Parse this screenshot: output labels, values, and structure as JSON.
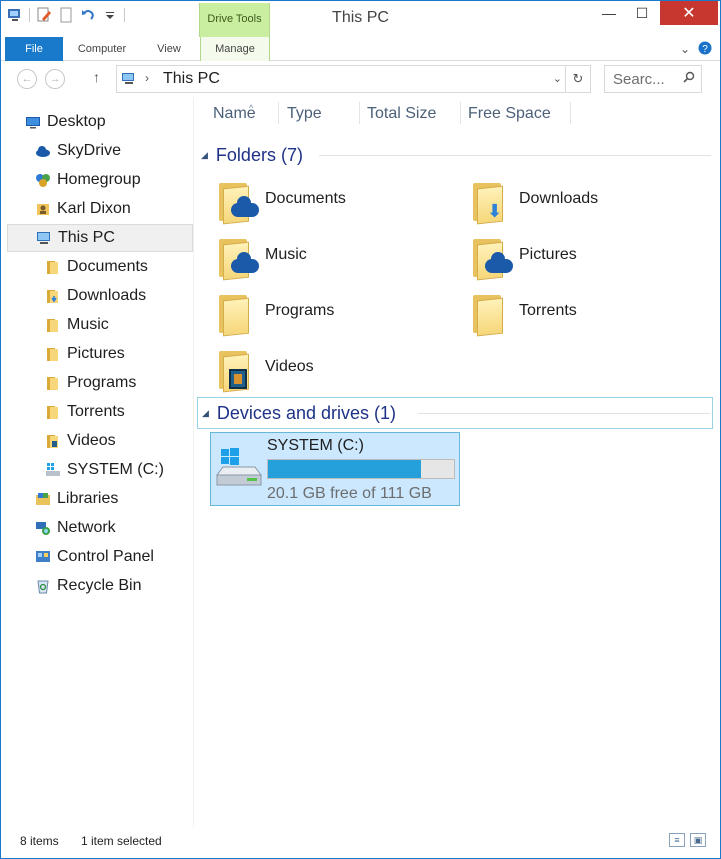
{
  "window": {
    "title": "This PC"
  },
  "titlebar": {
    "context_tab_group": "Drive Tools",
    "minimize": "—",
    "maximize": "☐",
    "close": "✕"
  },
  "ribbon": {
    "tabs": [
      "File",
      "Computer",
      "View",
      "Manage"
    ],
    "expand": "⌄",
    "help": "?"
  },
  "address": {
    "crumb": "This PC",
    "search_placeholder": "Searc..."
  },
  "nav_pane": {
    "items": [
      {
        "label": "Desktop",
        "icon": "desktop-icon"
      },
      {
        "label": "SkyDrive",
        "icon": "skydrive-icon"
      },
      {
        "label": "Homegroup",
        "icon": "homegroup-icon"
      },
      {
        "label": "Karl Dixon",
        "icon": "user-folder-icon"
      },
      {
        "label": "This PC",
        "icon": "this-pc-icon",
        "selected": true
      },
      {
        "label": "Documents",
        "icon": "folder-icon"
      },
      {
        "label": "Downloads",
        "icon": "folder-icon"
      },
      {
        "label": "Music",
        "icon": "folder-icon"
      },
      {
        "label": "Pictures",
        "icon": "folder-icon"
      },
      {
        "label": "Programs",
        "icon": "folder-icon"
      },
      {
        "label": "Torrents",
        "icon": "folder-icon"
      },
      {
        "label": "Videos",
        "icon": "folder-icon"
      },
      {
        "label": "SYSTEM (C:)",
        "icon": "drive-icon"
      },
      {
        "label": "Libraries",
        "icon": "libraries-icon"
      },
      {
        "label": "Network",
        "icon": "network-icon"
      },
      {
        "label": "Control Panel",
        "icon": "control-panel-icon"
      },
      {
        "label": "Recycle Bin",
        "icon": "recycle-bin-icon"
      }
    ]
  },
  "columns": [
    "Name",
    "Type",
    "Total Size",
    "Free Space"
  ],
  "groups": {
    "folders": {
      "title": "Folders (7)",
      "items": [
        {
          "name": "Documents",
          "overlay": "cloud"
        },
        {
          "name": "Downloads",
          "overlay": "download-arrow"
        },
        {
          "name": "Music",
          "overlay": "cloud"
        },
        {
          "name": "Pictures",
          "overlay": "cloud"
        },
        {
          "name": "Programs",
          "overlay": "none"
        },
        {
          "name": "Torrents",
          "overlay": "none"
        },
        {
          "name": "Videos",
          "overlay": "film"
        }
      ]
    },
    "devices": {
      "title": "Devices and drives (1)",
      "drive": {
        "name": "SYSTEM (C:)",
        "free_text": "20.1 GB free of 111 GB",
        "used_fraction": 0.82
      }
    }
  },
  "status": {
    "item_count": "8 items",
    "selection": "1 item selected"
  },
  "colors": {
    "accent": "#1979ca",
    "group_title": "#1e3287",
    "selection_bg": "#cce8ff",
    "drive_bar": "#26a0da",
    "context_tab": "#c9eea0",
    "close_button": "#c7372f"
  }
}
